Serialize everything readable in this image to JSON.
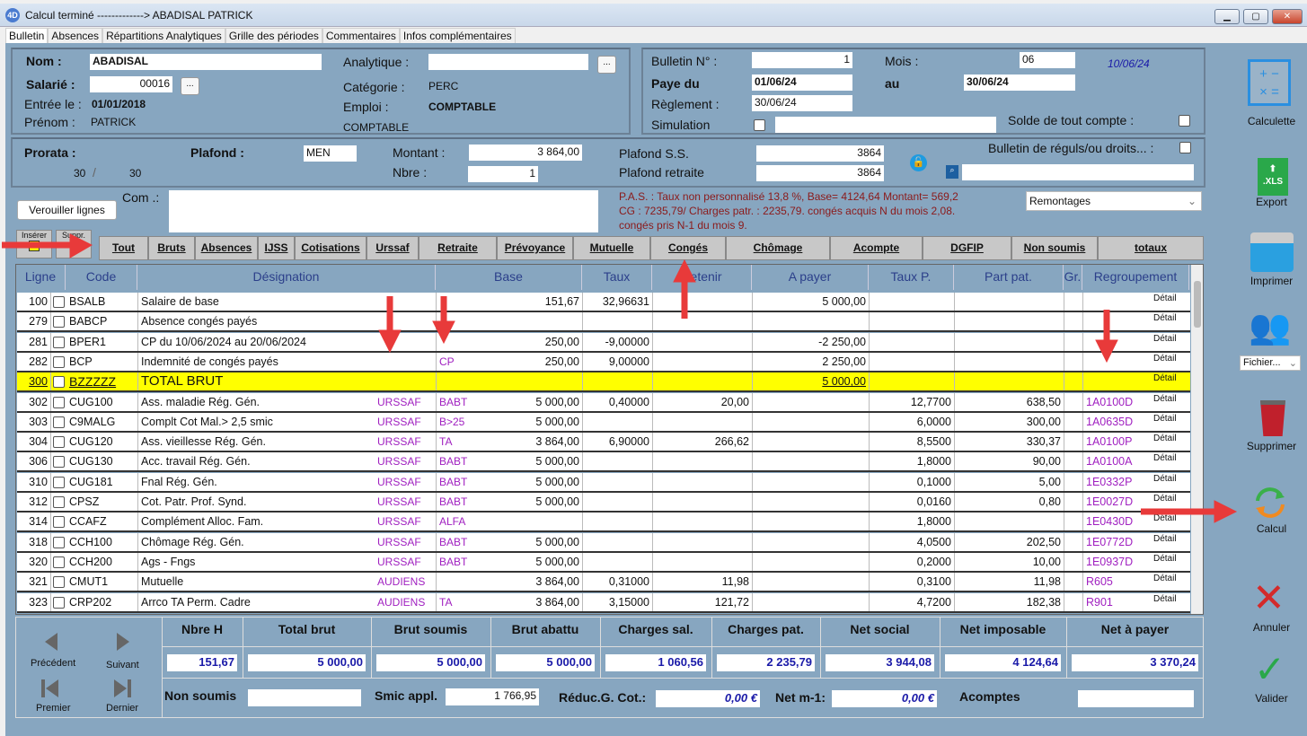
{
  "window": {
    "title": "Calcul terminé ------------->  ABADISAL PATRICK",
    "min": "▁",
    "max": "▢",
    "close": "✕"
  },
  "tabs": [
    "Bulletin",
    "Absences",
    "Répartitions Analytiques",
    "Grille des périodes",
    "Commentaires",
    "Infos complémentaires"
  ],
  "employee": {
    "nom_label": "Nom :",
    "nom": "ABADISAL",
    "salarie_label": "Salarié :",
    "salarie": "00016",
    "entree_label": "Entrée le :",
    "entree": "01/01/2018",
    "prenom_label": "Prénom :",
    "prenom": "PATRICK",
    "analytique_label": "Analytique :",
    "analytique": "",
    "categorie_label": "Catégorie :",
    "categorie": "PERC",
    "emploi_label": "Emploi :",
    "emploi": "COMPTABLE",
    "emploi2": "COMPTABLE",
    "dots": "..."
  },
  "bulletin": {
    "num_label": "Bulletin N° :",
    "num": "1",
    "mois_label": "Mois :",
    "mois": "06",
    "date": "10/06/24",
    "paye_du_label": "Paye du",
    "paye_du": "01/06/24",
    "au_label": "au",
    "au": "30/06/24",
    "reglement_label": "Règlement :",
    "reglement": "30/06/24",
    "simulation_label": "Simulation",
    "simulation_text": "",
    "solde_label": "Solde de tout compte :"
  },
  "prorata": {
    "label": "Prorata :",
    "a": "30",
    "b": "30",
    "plafond_label": "Plafond :",
    "plafond": "MEN",
    "montant_label": "Montant :",
    "montant": "3 864,00",
    "nbre_label": "Nbre :",
    "nbre": "1",
    "plafond_ss_label": "Plafond S.S.",
    "plafond_ss": "3864",
    "plafond_ret_label": "Plafond retraite",
    "plafond_ret": "3864",
    "reguls_label": "Bulletin de réguls/ou droits... :",
    "search_value": ""
  },
  "com": {
    "lock_button": "Verouiller lignes",
    "label": "Com .:",
    "value": "",
    "info": [
      "P.A.S. : Taux non personnalisé 13,8 %, Base= 4124,64 Montant= 569,2",
      "CG : 7235,79/ Charges patr. : 2235,79. congés acquis N du mois 2,08.",
      "congés pris N-1 du mois 9."
    ],
    "remontages": "Remontages",
    "inserer": "Insérer",
    "suppr": "Suppr."
  },
  "filter_tabs": [
    "Tout",
    "Bruts",
    "Absences",
    "IJSS",
    "Cotisations",
    "Urssaf",
    "Retraite",
    "Prévoyance",
    "Mutuelle",
    "Congés",
    "Chômage",
    "Acompte",
    "DGFIP",
    "Non soumis",
    "totaux"
  ],
  "columns": [
    "Ligne",
    "Code",
    "Désignation",
    "Base",
    "Taux",
    "Retenir",
    "A payer",
    "Taux P.",
    "Part pat.",
    "Gr.",
    "Regroupement"
  ],
  "rows": [
    {
      "ligne": "100",
      "code": "BSALB",
      "designation": "Salaire de base",
      "organisme": "",
      "base_code": "",
      "base": "151,67",
      "taux": "32,96631",
      "retenir": "",
      "a_payer": "5 000,00",
      "taux_p": "",
      "part_pat": "",
      "gr": "",
      "regroupement": "",
      "detail": "Détail"
    },
    {
      "ligne": "279",
      "code": "BABCP",
      "designation": "Absence congés payés",
      "organisme": "",
      "base_code": "",
      "base": "",
      "taux": "",
      "retenir": "",
      "a_payer": "",
      "taux_p": "",
      "part_pat": "",
      "gr": "",
      "regroupement": "",
      "detail": "Détail"
    },
    {
      "ligne": "281",
      "code": "BPER1",
      "designation": "CP du 10/06/2024 au 20/06/2024",
      "organisme": "",
      "base_code": "",
      "base": "250,00",
      "taux": "-9,00000",
      "retenir": "",
      "a_payer": "-2 250,00",
      "taux_p": "",
      "part_pat": "",
      "gr": "",
      "regroupement": "",
      "detail": "Détail"
    },
    {
      "ligne": "282",
      "code": "BCP",
      "designation": "Indemnité de congés payés",
      "organisme": "",
      "base_code": "CP",
      "base": "250,00",
      "taux": "9,00000",
      "retenir": "",
      "a_payer": "2 250,00",
      "taux_p": "",
      "part_pat": "",
      "gr": "",
      "regroupement": "",
      "detail": "Détail"
    },
    {
      "ligne": "300",
      "code": "BZZZZZ",
      "designation": "TOTAL BRUT",
      "organisme": "",
      "base_code": "",
      "base": "",
      "taux": "",
      "retenir": "",
      "a_payer": "5 000,00",
      "taux_p": "",
      "part_pat": "",
      "gr": "",
      "regroupement": "",
      "detail": "Détail",
      "highlight": true
    },
    {
      "ligne": "302",
      "code": "CUG100",
      "designation": "Ass. maladie Rég. Gén.",
      "organisme": "URSSAF",
      "base_code": "BABT",
      "base": "5 000,00",
      "taux": "0,40000",
      "retenir": "20,00",
      "a_payer": "",
      "taux_p": "12,7700",
      "part_pat": "638,50",
      "gr": "",
      "regroupement": "1A0100D",
      "detail": "Détail"
    },
    {
      "ligne": "303",
      "code": "C9MALG",
      "designation": "Complt Cot Mal.> 2,5 smic",
      "organisme": "URSSAF",
      "base_code": "B>25",
      "base": "5 000,00",
      "taux": "",
      "retenir": "",
      "a_payer": "",
      "taux_p": "6,0000",
      "part_pat": "300,00",
      "gr": "",
      "regroupement": "1A0635D",
      "detail": "Détail"
    },
    {
      "ligne": "304",
      "code": "CUG120",
      "designation": "Ass. vieillesse Rég. Gén.",
      "organisme": "URSSAF",
      "base_code": "TA",
      "base": "3 864,00",
      "taux": "6,90000",
      "retenir": "266,62",
      "a_payer": "",
      "taux_p": "8,5500",
      "part_pat": "330,37",
      "gr": "",
      "regroupement": "1A0100P",
      "detail": "Détail"
    },
    {
      "ligne": "306",
      "code": "CUG130",
      "designation": "Acc. travail Rég. Gén.",
      "organisme": "URSSAF",
      "base_code": "BABT",
      "base": "5 000,00",
      "taux": "",
      "retenir": "",
      "a_payer": "",
      "taux_p": "1,8000",
      "part_pat": "90,00",
      "gr": "",
      "regroupement": "1A0100A",
      "detail": "Détail"
    },
    {
      "ligne": "310",
      "code": "CUG181",
      "designation": "Fnal Rég. Gén.",
      "organisme": "URSSAF",
      "base_code": "BABT",
      "base": "5 000,00",
      "taux": "",
      "retenir": "",
      "a_payer": "",
      "taux_p": "0,1000",
      "part_pat": "5,00",
      "gr": "",
      "regroupement": "1E0332P",
      "detail": "Détail"
    },
    {
      "ligne": "312",
      "code": "CPSZ",
      "designation": "Cot. Patr. Prof. Synd.",
      "organisme": "URSSAF",
      "base_code": "BABT",
      "base": "5 000,00",
      "taux": "",
      "retenir": "",
      "a_payer": "",
      "taux_p": "0,0160",
      "part_pat": "0,80",
      "gr": "",
      "regroupement": "1E0027D",
      "detail": "Détail"
    },
    {
      "ligne": "314",
      "code": "CCAFZ",
      "designation": "Complément Alloc. Fam.",
      "organisme": "URSSAF",
      "base_code": "ALFA",
      "base": "",
      "taux": "",
      "retenir": "",
      "a_payer": "",
      "taux_p": "1,8000",
      "part_pat": "",
      "gr": "",
      "regroupement": "1E0430D",
      "detail": "Détail"
    },
    {
      "ligne": "318",
      "code": "CCH100",
      "designation": "Chômage Rég. Gén.",
      "organisme": "URSSAF",
      "base_code": "BABT",
      "base": "5 000,00",
      "taux": "",
      "retenir": "",
      "a_payer": "",
      "taux_p": "4,0500",
      "part_pat": "202,50",
      "gr": "",
      "regroupement": "1E0772D",
      "detail": "Détail"
    },
    {
      "ligne": "320",
      "code": "CCH200",
      "designation": "Ags - Fngs",
      "organisme": "URSSAF",
      "base_code": "BABT",
      "base": "5 000,00",
      "taux": "",
      "retenir": "",
      "a_payer": "",
      "taux_p": "0,2000",
      "part_pat": "10,00",
      "gr": "",
      "regroupement": "1E0937D",
      "detail": "Détail"
    },
    {
      "ligne": "321",
      "code": "CMUT1",
      "designation": "Mutuelle",
      "organisme": "AUDIENS",
      "base_code": "",
      "base": "3 864,00",
      "taux": "0,31000",
      "retenir": "11,98",
      "a_payer": "",
      "taux_p": "0,3100",
      "part_pat": "11,98",
      "gr": "",
      "regroupement": "R605",
      "detail": "Détail"
    },
    {
      "ligne": "323",
      "code": "CRP202",
      "designation": "Arrco TA Perm. Cadre",
      "organisme": "AUDIENS",
      "base_code": "TA",
      "base": "3 864,00",
      "taux": "3,15000",
      "retenir": "121,72",
      "a_payer": "",
      "taux_p": "4,7200",
      "part_pat": "182,38",
      "gr": "",
      "regroupement": "R901",
      "detail": "Détail"
    }
  ],
  "totals": {
    "headers": [
      "Nbre H",
      "Total brut",
      "Brut soumis",
      "Brut abattu",
      "Charges sal.",
      "Charges pat.",
      "Net social",
      "Net imposable",
      "Net à payer"
    ],
    "values": [
      "151,67",
      "5 000,00",
      "5 000,00",
      "5 000,00",
      "1 060,56",
      "2 235,79",
      "3 944,08",
      "4 124,64",
      "3 370,24"
    ],
    "non_soumis_label": "Non soumis",
    "non_soumis": "",
    "smic_label": "Smic appl.",
    "smic": "1 766,95",
    "reduc_label": "Réduc.G. Cot.:",
    "reduc": "0,00 €",
    "net_m1_label": "Net m-1:",
    "net_m1": "0,00 €",
    "acomptes_label": "Acomptes",
    "acomptes": ""
  },
  "nav": {
    "precedent": "Précédent",
    "suivant": "Suivant",
    "premier": "Premier",
    "dernier": "Dernier"
  },
  "sidebar": {
    "calculette": "Calculette",
    "export": "Export",
    "imprimer": "Imprimer",
    "fichier": "Fichier...",
    "supprimer": "Supprimer",
    "calcul": "Calcul",
    "annuler": "Annuler",
    "valider": "Valider"
  },
  "colors": {
    "background": "#87a6c0",
    "highlight_row": "#ffff00",
    "organism_text": "#a020c0",
    "totals_text": "#1a1aa8",
    "info_text": "#8b1a1a",
    "annotation_arrow": "#e83a3a"
  }
}
